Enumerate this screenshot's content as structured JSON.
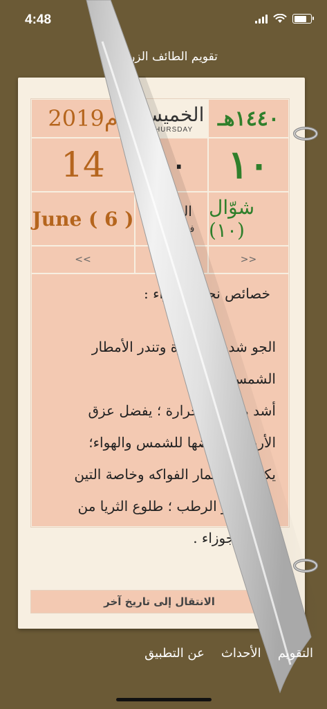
{
  "status_bar": {
    "time": "4:48",
    "battery_percent": 85
  },
  "app_title": "تقويم الطائف الزراعي",
  "calendar": {
    "hijri_year": "١٤٤٠هـ",
    "weekday_ar": "الخميس",
    "weekday_en": "THURSDAY",
    "gregorian_year": "2019م",
    "hijri_day": "١٠",
    "season_day": "١٠",
    "gregorian_day": "14",
    "hijri_month": "شوّال (١٠)",
    "season_name": "الجوزاء",
    "season_subtitle": "فصل القيظ",
    "gregorian_month": "June ( 6 )",
    "nav_next": ">>",
    "nav_prev": "<<"
  },
  "info": {
    "title": "خصائص نجم الجوزاء :",
    "lines": [
      "الجو شديد الحرارة وتندر الأمطار الشمس",
      "أشد ما تكون حرارة ؛ يفضل عزق",
      "الأرض لتعريضها للشمس والهواء؛",
      "يكثف فيها ثمار الفواكه وخاصة التين",
      "و العنب و الرطب ؛ طلوع الثريا من",
      "نجوم الجوزاء ."
    ]
  },
  "goto_button": "الانتقال إلى تاريخ آخر",
  "tabs": [
    "التقويم",
    "الأحداث",
    "عن التطبيق"
  ],
  "colors": {
    "background": "#6b5a36",
    "page": "#f7efe1",
    "cell": "#f3c9b2",
    "hijri": "#2f7f2b",
    "gregorian": "#b5651d"
  }
}
